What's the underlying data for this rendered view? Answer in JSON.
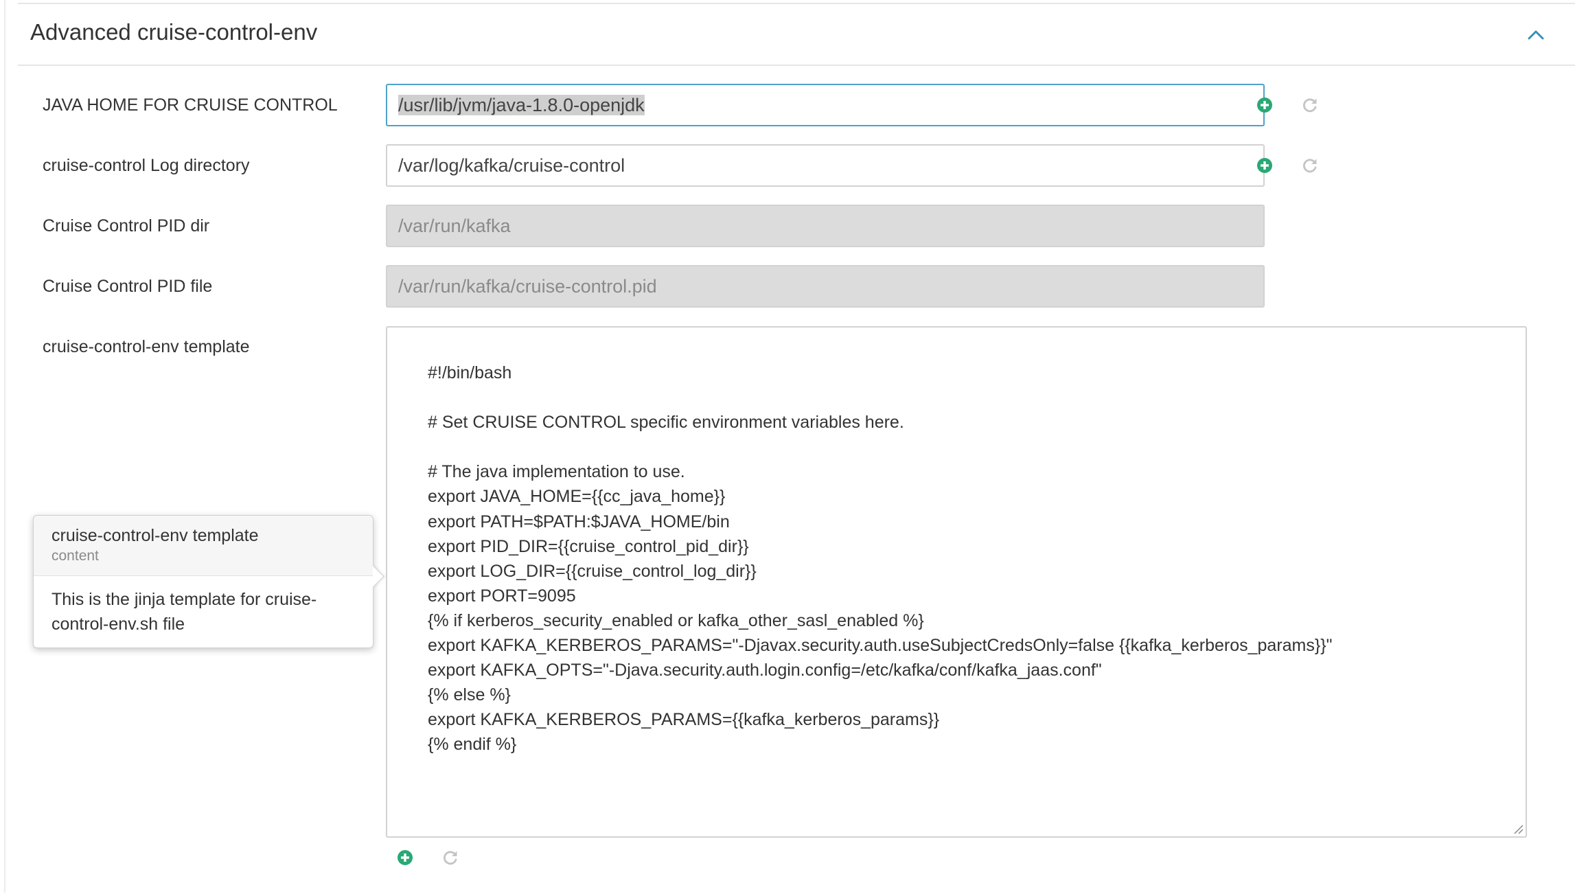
{
  "section": {
    "title": "Advanced cruise-control-env"
  },
  "fields": {
    "java_home": {
      "label": "JAVA HOME FOR CRUISE CONTROL",
      "value": "/usr/lib/jvm/java-1.8.0-openjdk"
    },
    "log_dir": {
      "label": "cruise-control Log directory",
      "value": "/var/log/kafka/cruise-control"
    },
    "pid_dir": {
      "label": "Cruise Control PID dir",
      "value": "/var/run/kafka"
    },
    "pid_file": {
      "label": "Cruise Control PID file",
      "value": "/var/run/kafka/cruise-control.pid"
    },
    "template": {
      "label": "cruise-control-env template",
      "content": "#!/bin/bash\n\n# Set CRUISE CONTROL specific environment variables here.\n\n# The java implementation to use.\nexport JAVA_HOME={{cc_java_home}}\nexport PATH=$PATH:$JAVA_HOME/bin\nexport PID_DIR={{cruise_control_pid_dir}}\nexport LOG_DIR={{cruise_control_log_dir}}\nexport PORT=9095\n{% if kerberos_security_enabled or kafka_other_sasl_enabled %}\nexport KAFKA_KERBEROS_PARAMS=\"-Djavax.security.auth.useSubjectCredsOnly=false {{kafka_kerberos_params}}\"\nexport KAFKA_OPTS=\"-Djava.security.auth.login.config=/etc/kafka/conf/kafka_jaas.conf\"\n{% else %}\nexport KAFKA_KERBEROS_PARAMS={{kafka_kerberos_params}}\n{% endif %}"
    }
  },
  "popover": {
    "title": "cruise-control-env template",
    "subtitle": "content",
    "body": "This is the jinja template for cruise-control-env.sh file"
  },
  "icons": {
    "add": "plus-circle-icon",
    "reset": "refresh-icon",
    "collapse": "chevron-up-icon"
  },
  "colors": {
    "add_icon": "#2aa876",
    "reset_icon": "#c4c4c4",
    "focus_border": "#4fa1c7",
    "chevron": "#3a8fb7"
  }
}
